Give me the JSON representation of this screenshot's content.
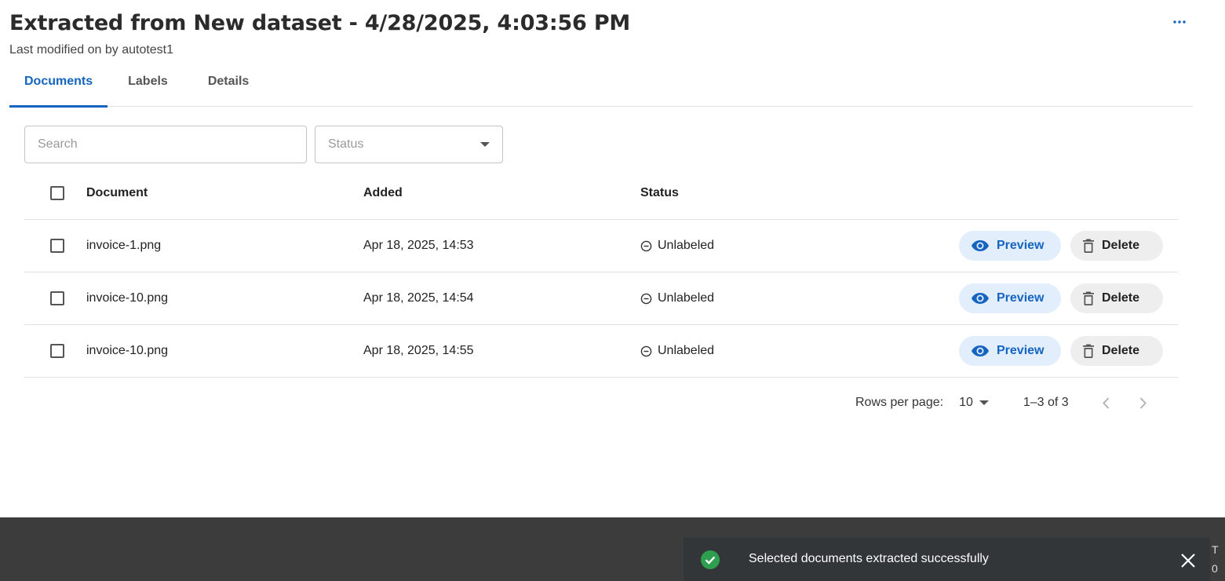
{
  "header": {
    "title": "Extracted from New dataset - 4/28/2025, 4:03:56 PM",
    "subtitle": "Last modified on by autotest1",
    "more_icon": "more-horizontal-icon"
  },
  "tabs": [
    {
      "label": "Documents",
      "active": true
    },
    {
      "label": "Labels",
      "active": false
    },
    {
      "label": "Details",
      "active": false
    }
  ],
  "filters": {
    "search_placeholder": "Search",
    "status_placeholder": "Status"
  },
  "table": {
    "columns": [
      "Document",
      "Added",
      "Status"
    ],
    "rows": [
      {
        "document": "invoice-1.png",
        "added": "Apr 18, 2025, 14:53",
        "status": "Unlabeled",
        "preview": "Preview",
        "delete": "Delete"
      },
      {
        "document": "invoice-10.png",
        "added": "Apr 18, 2025, 14:54",
        "status": "Unlabeled",
        "preview": "Preview",
        "delete": "Delete"
      },
      {
        "document": "invoice-10.png",
        "added": "Apr 18, 2025, 14:55",
        "status": "Unlabeled",
        "preview": "Preview",
        "delete": "Delete"
      }
    ]
  },
  "pagination": {
    "rows_per_page_label": "Rows per page:",
    "rows_per_page": "10",
    "range": "1–3 of 3"
  },
  "toast": {
    "message": "Selected documents extracted successfully",
    "icon": "check-circle-icon"
  },
  "edge_text": [
    "T",
    "0"
  ],
  "colors": {
    "accent": "#1565c0",
    "preview_bg": "#e3eefc",
    "success": "#2e9e4f",
    "toast_bg": "#323639"
  }
}
